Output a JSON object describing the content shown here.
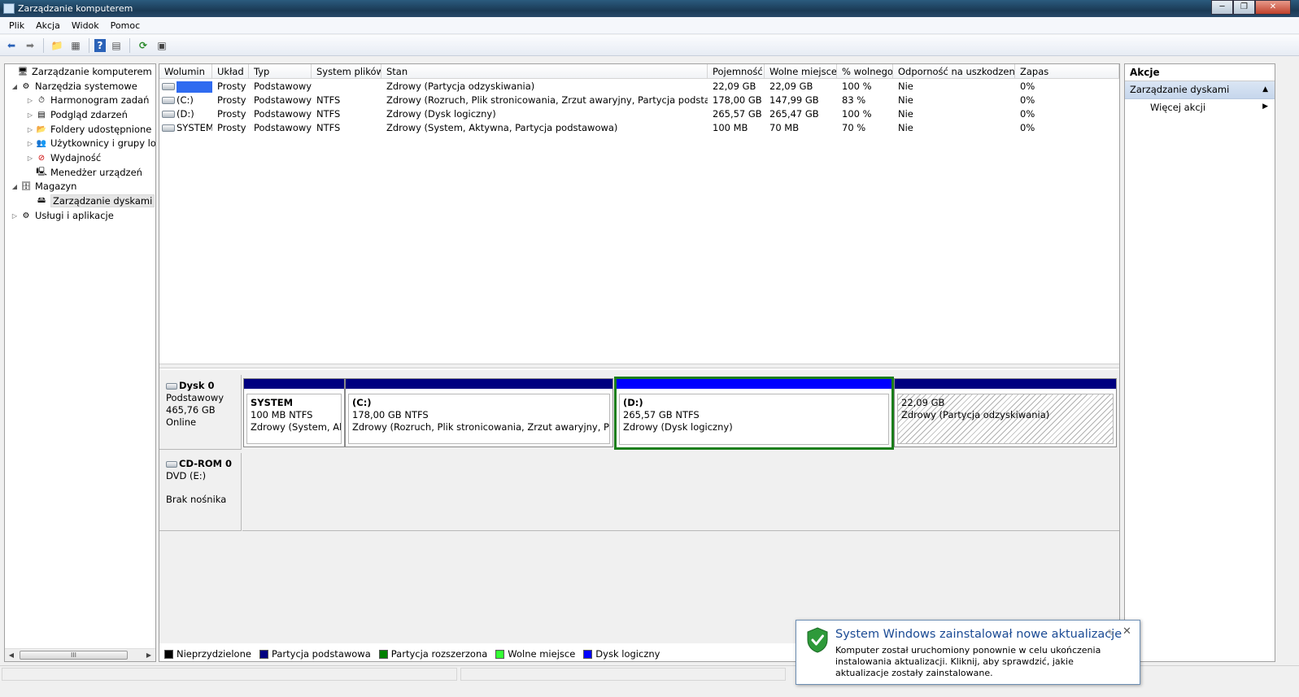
{
  "window": {
    "title": "Zarządzanie komputerem",
    "minimize_glyph": "─",
    "maximize_glyph": "❐",
    "close_glyph": "✕"
  },
  "menu": [
    "Plik",
    "Akcja",
    "Widok",
    "Pomoc"
  ],
  "toolbar": {
    "icons": [
      "back-icon",
      "forward-icon",
      "up-folder-icon",
      "show-hide-tree-icon",
      "help-icon",
      "show-hide-action-pane-icon",
      "refresh-icon",
      "export-list-icon"
    ],
    "glyphs": {
      "back": "⬅",
      "forward": "➡",
      "up": "📁",
      "tree": "▦",
      "help": "?",
      "action": "▤",
      "refresh": "⟳",
      "export": "▣"
    }
  },
  "tree": {
    "items": [
      {
        "label": "Zarządzanie komputerem (loka",
        "icon": "computer-management-icon",
        "arrow": "",
        "level": 0,
        "glyph": "🖥"
      },
      {
        "label": "Narzędzia systemowe",
        "icon": "system-tools-icon",
        "arrow": "◢",
        "level": 1,
        "glyph": "⚙"
      },
      {
        "label": "Harmonogram zadań",
        "icon": "task-scheduler-icon",
        "arrow": "▷",
        "level": 2,
        "glyph": "⏱"
      },
      {
        "label": "Podgląd zdarzeń",
        "icon": "event-viewer-icon",
        "arrow": "▷",
        "level": 2,
        "glyph": "▤"
      },
      {
        "label": "Foldery udostępnione",
        "icon": "shared-folders-icon",
        "arrow": "▷",
        "level": 2,
        "glyph": "📂"
      },
      {
        "label": "Użytkownicy i grupy lok",
        "icon": "users-groups-icon",
        "arrow": "▷",
        "level": 2,
        "glyph": "👥"
      },
      {
        "label": "Wydajność",
        "icon": "performance-icon",
        "arrow": "▷",
        "level": 2,
        "glyph": "⊘"
      },
      {
        "label": "Menedżer urządzeń",
        "icon": "device-manager-icon",
        "arrow": "",
        "level": 2,
        "glyph": "🖳"
      },
      {
        "label": "Magazyn",
        "icon": "storage-icon",
        "arrow": "◢",
        "level": 1,
        "glyph": "🗄"
      },
      {
        "label": "Zarządzanie dyskami",
        "icon": "disk-management-icon",
        "arrow": "",
        "level": 2,
        "glyph": "🖴",
        "selected": true
      },
      {
        "label": "Usługi i aplikacje",
        "icon": "services-apps-icon",
        "arrow": "▷",
        "level": 1,
        "glyph": "⚙"
      }
    ],
    "scroll_left": "◀",
    "scroll_right": "▶",
    "scroll_grip": "III"
  },
  "volumes": {
    "columns": [
      "Wolumin",
      "Układ",
      "Typ",
      "System plików",
      "Stan",
      "Pojemność",
      "Wolne miejsce",
      "% wolnego",
      "Odporność na uszkodzenia",
      "Zapas"
    ],
    "rows": [
      {
        "volume": "",
        "redacted": true,
        "layout": "Prosty",
        "type": "Podstawowy",
        "fs": "",
        "status": "Zdrowy (Partycja odzyskiwania)",
        "capacity": "22,09 GB",
        "free": "22,09 GB",
        "pct_free": "100 %",
        "fault_tolerance": "Nie",
        "overhead": "0%"
      },
      {
        "volume": "(C:)",
        "layout": "Prosty",
        "type": "Podstawowy",
        "fs": "NTFS",
        "status": "Zdrowy (Rozruch, Plik stronicowania, Zrzut awaryjny, Partycja podstawowa)",
        "capacity": "178,00 GB",
        "free": "147,99 GB",
        "pct_free": "83 %",
        "fault_tolerance": "Nie",
        "overhead": "0%"
      },
      {
        "volume": "(D:)",
        "layout": "Prosty",
        "type": "Podstawowy",
        "fs": "NTFS",
        "status": "Zdrowy (Dysk logiczny)",
        "capacity": "265,57 GB",
        "free": "265,47 GB",
        "pct_free": "100 %",
        "fault_tolerance": "Nie",
        "overhead": "0%"
      },
      {
        "volume": "SYSTEM",
        "layout": "Prosty",
        "type": "Podstawowy",
        "fs": "NTFS",
        "status": "Zdrowy (System, Aktywna, Partycja podstawowa)",
        "capacity": "100 MB",
        "free": "70 MB",
        "pct_free": "70 %",
        "fault_tolerance": "Nie",
        "overhead": "0%"
      }
    ]
  },
  "disks": [
    {
      "name": "Dysk 0",
      "type": "Podstawowy",
      "size": "465,76 GB",
      "state": "Online",
      "partitions": [
        {
          "name": "SYSTEM",
          "size_fs": "100 MB NTFS",
          "status": "Zdrowy (System, Aktywna, Partycja podstawowa)",
          "kind": "primary"
        },
        {
          "name": "(C:)",
          "size_fs": "178,00 GB NTFS",
          "status": "Zdrowy (Rozruch, Plik stronicowania, Zrzut awaryjny, Partycja podstawowa)",
          "kind": "primary"
        },
        {
          "name": "(D:)",
          "size_fs": "265,57 GB NTFS",
          "status": "Zdrowy (Dysk logiczny)",
          "kind": "logical",
          "selected": true
        },
        {
          "name": "",
          "size_fs": "22,09 GB",
          "status": "Zdrowy (Partycja odzyskiwania)",
          "kind": "primary",
          "hatched": true
        }
      ]
    },
    {
      "name": "CD-ROM 0",
      "type": "DVD (E:)",
      "size": "",
      "state": "Brak nośnika",
      "partitions": []
    }
  ],
  "legend": [
    {
      "label": "Nieprzydzielone",
      "color": "#000000"
    },
    {
      "label": "Partycja podstawowa",
      "color": "#000080"
    },
    {
      "label": "Partycja rozszerzona",
      "color": "#008000"
    },
    {
      "label": "Wolne miejsce",
      "color": "#33ff33"
    },
    {
      "label": "Dysk logiczny",
      "color": "#0000ff"
    }
  ],
  "actions": {
    "title": "Akcje",
    "section": "Zarządzanie dyskami",
    "section_caret": "▲",
    "more": "Więcej akcji",
    "more_caret": "▶"
  },
  "notification": {
    "title": "System Windows zainstalował nowe aktualizacje",
    "body": "Komputer został uruchomiony ponownie w celu ukończenia instalowania aktualizacji. Kliknij, aby sprawdzić, jakie aktualizacje zostały zainstalowane.",
    "pin_glyph": "✎",
    "close_glyph": "✕",
    "icon": "windows-update-shield-icon"
  }
}
